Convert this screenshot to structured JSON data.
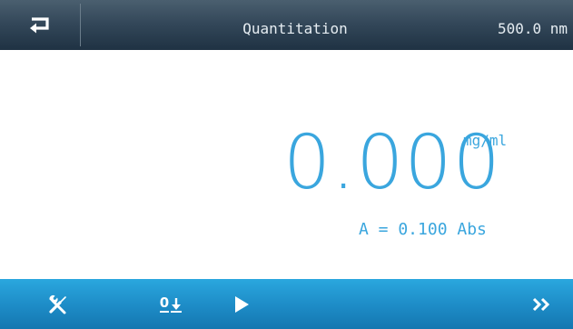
{
  "header": {
    "title": "Quantitation",
    "wavelength": "500.0 nm",
    "back_icon": "return-arrow-icon"
  },
  "measurement": {
    "concentration_value": "0.000",
    "concentration_unit": "mg/ml",
    "absorbance_readout": "A = 0.100 Abs"
  },
  "toolbar": {
    "settings_icon": "tools-icon",
    "zero_label": "0",
    "zero_icon": "zero-arrow-down-icon",
    "play_icon": "play-icon",
    "next_icon": "double-chevron-right-icon"
  },
  "colors": {
    "header_dark": "#34485a",
    "accent_blue": "#3aa6de",
    "toolbar_blue": "#1d8bc6",
    "header_text": "#e6edf2"
  }
}
